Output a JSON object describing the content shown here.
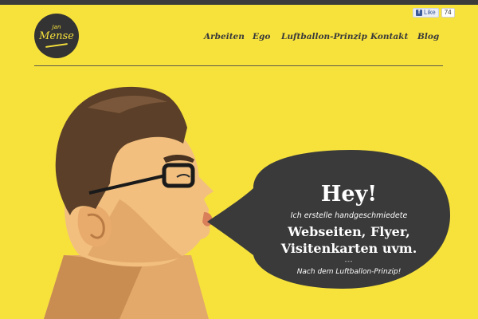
{
  "logo": {
    "line1": "Jan",
    "line2": "Mense"
  },
  "facebook": {
    "label": "Like",
    "count": "74"
  },
  "nav": {
    "items": [
      {
        "label": "Arbeiten"
      },
      {
        "label": "Ego"
      },
      {
        "label": "Luftballon-Prinzip"
      },
      {
        "label": "Kontakt"
      },
      {
        "label": "Blog"
      }
    ]
  },
  "bubble": {
    "heading": "Hey!",
    "intro": "Ich erstelle handgeschmiedete",
    "highlight_line1": "Webseiten, Flyer,",
    "highlight_line2": "Visitenkarten uvm.",
    "separator": "---",
    "footer": "Nach dem Luftballon-Prinzip!"
  },
  "colors": {
    "background": "#f7e23c",
    "bubble": "#3a3a3a",
    "nav_text": "#3a3a3a"
  }
}
